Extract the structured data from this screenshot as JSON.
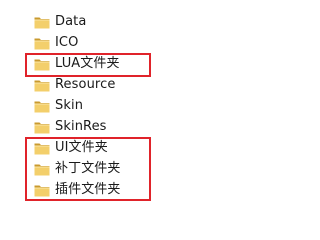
{
  "folders": [
    {
      "name": "Data",
      "icon": "folder-icon"
    },
    {
      "name": "ICO",
      "icon": "folder-icon"
    },
    {
      "name": "LUA文件夹",
      "icon": "folder-icon"
    },
    {
      "name": "Resource",
      "icon": "folder-icon"
    },
    {
      "name": "Skin",
      "icon": "folder-icon"
    },
    {
      "name": "SkinRes",
      "icon": "folder-icon"
    },
    {
      "name": "UI文件夹",
      "icon": "folder-icon"
    },
    {
      "name": "补丁文件夹",
      "icon": "folder-icon"
    },
    {
      "name": "插件文件夹",
      "icon": "folder-icon"
    }
  ],
  "colors": {
    "highlight_border": "#e0232a",
    "folder_body": "#e9c25a",
    "folder_dark": "#c99a2e"
  }
}
